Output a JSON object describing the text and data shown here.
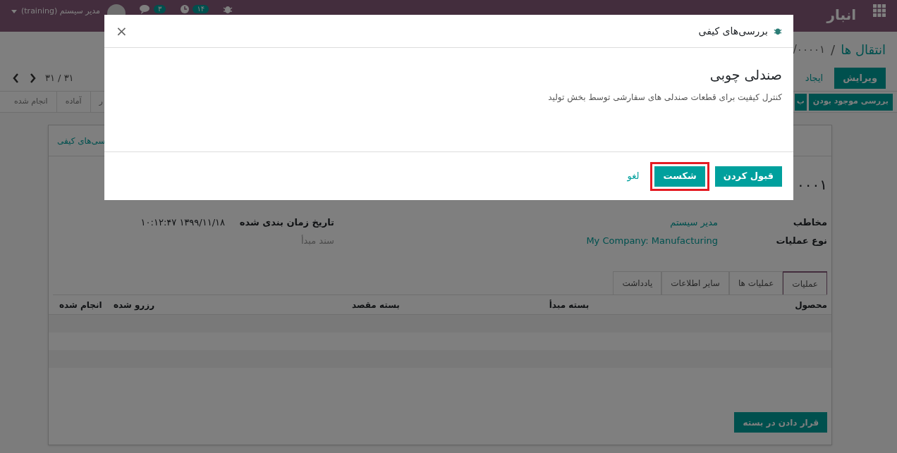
{
  "navbar": {
    "app_name": "انبار",
    "user": "مدیر سیستم (training)",
    "message_count": "۳",
    "activity_count": "۱۴"
  },
  "breadcrumb": {
    "separator": "/",
    "items": [
      {
        "label": "انتقال ها",
        "kind": "link"
      },
      {
        "label": "/۰۰۰۰۱",
        "kind": "current"
      }
    ]
  },
  "actions": {
    "buttons": [
      {
        "label": "ویرایش",
        "kind": "primary"
      },
      {
        "label": "ایجاد",
        "kind": "secondary"
      }
    ],
    "pager": "۳۱ / ۳۱"
  },
  "status_bar": {
    "buttons": [
      "بررسی موجود بودن",
      "ب"
    ],
    "stages": [
      {
        "label": "ر",
        "selected": false
      },
      {
        "label": "آماده",
        "selected": false
      },
      {
        "label": "انجام شده",
        "selected": false
      }
    ]
  },
  "sheet": {
    "smart_button": "سی‌های کیفی",
    "title": "۰۰۰۱",
    "fields_right": [
      {
        "label": "مخاطب",
        "value": "مدیر سیستم",
        "kind": "link"
      },
      {
        "label": "نوع عملیات",
        "value": "My Company: Manufacturing",
        "kind": "link"
      }
    ],
    "fields_left": [
      {
        "label": "تاریخ زمان بندی شده",
        "value": "۱۳۹۹/۱۱/۱۸ ۱۰:۱۲:۴۷",
        "kind": "text"
      },
      {
        "label": "سند مبدأ",
        "kind": "placeholder"
      }
    ],
    "tabs": [
      {
        "label": "عملیات",
        "selected": true
      },
      {
        "label": "عملیات ها",
        "selected": false
      },
      {
        "label": "سایر اطلاعات",
        "selected": false
      },
      {
        "label": "یادداشت",
        "selected": false
      }
    ],
    "table": {
      "columns": [
        "محصول",
        "بسته مبدأ",
        "بسته مقصد",
        "رزرو شده",
        "انجام شده"
      ]
    },
    "pack_button": "قرار دادن در بسته"
  },
  "dialog": {
    "title": "بررسی‌های کیفی",
    "close": "×",
    "heading": "صندلی چوبی",
    "description": "کنترل کیفیت برای قطعات صندلی های سفارشی توسط بخش تولید",
    "buttons": [
      {
        "label": "قبول کردن",
        "kind": "primary",
        "highlighted": false
      },
      {
        "label": "شکست",
        "kind": "primary",
        "highlighted": true
      },
      {
        "label": "لغو",
        "kind": "link",
        "highlighted": false
      }
    ]
  }
}
